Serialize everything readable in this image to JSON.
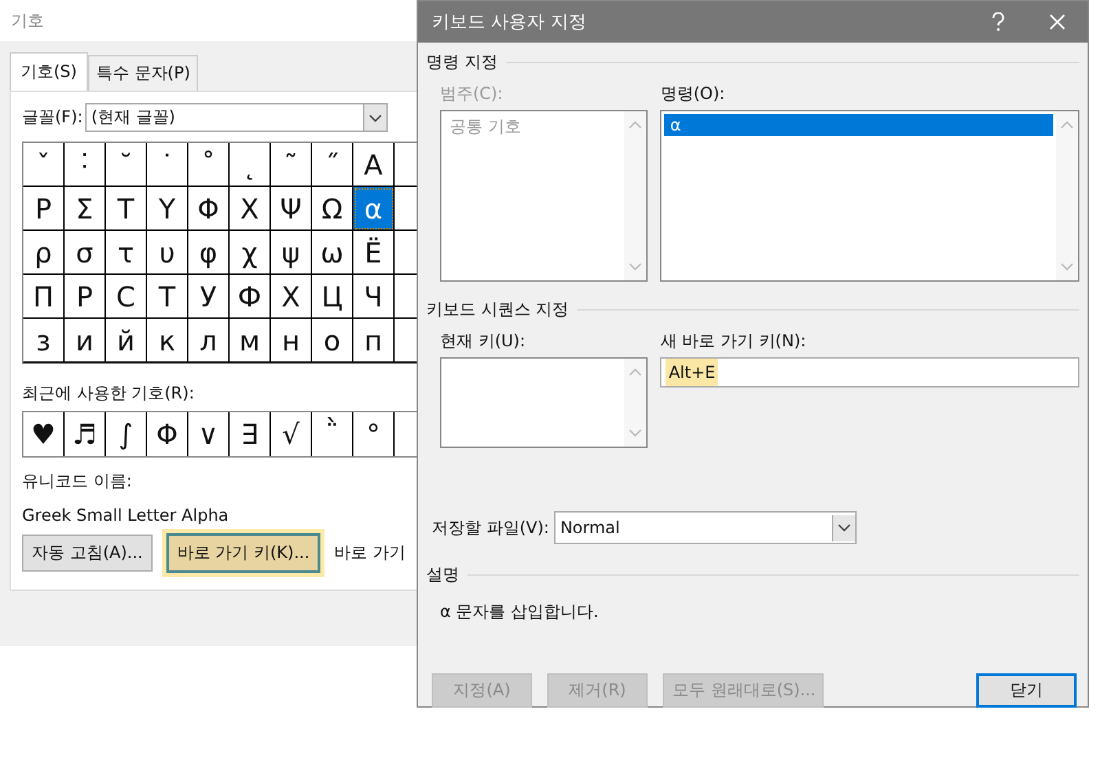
{
  "symbol_dialog": {
    "title": "기호",
    "tabs": [
      {
        "label": "기호(S)",
        "selected": true
      },
      {
        "label": "특수 문자(P)",
        "selected": false
      }
    ],
    "font": {
      "label": "글꼴(F):",
      "value": "(현재 글꼴)"
    },
    "symbol_grid": [
      [
        {
          "symbol": "ˇ",
          "selected": false
        },
        {
          "symbol": "˸",
          "selected": false
        },
        {
          "symbol": "˘",
          "selected": false
        },
        {
          "symbol": "˙",
          "selected": false
        },
        {
          "symbol": "˚",
          "selected": false
        },
        {
          "symbol": "˛",
          "selected": false
        },
        {
          "symbol": "˜",
          "selected": false
        },
        {
          "symbol": "˝",
          "selected": false
        },
        {
          "symbol": "Α",
          "selected": false
        }
      ],
      [
        {
          "symbol": "Ρ",
          "selected": false
        },
        {
          "symbol": "Σ",
          "selected": false
        },
        {
          "symbol": "Τ",
          "selected": false
        },
        {
          "symbol": "Υ",
          "selected": false
        },
        {
          "symbol": "Φ",
          "selected": false
        },
        {
          "symbol": "Χ",
          "selected": false
        },
        {
          "symbol": "Ψ",
          "selected": false
        },
        {
          "symbol": "Ω",
          "selected": false
        },
        {
          "symbol": "α",
          "selected": true
        }
      ],
      [
        {
          "symbol": "ρ",
          "selected": false
        },
        {
          "symbol": "σ",
          "selected": false
        },
        {
          "symbol": "τ",
          "selected": false
        },
        {
          "symbol": "υ",
          "selected": false
        },
        {
          "symbol": "φ",
          "selected": false
        },
        {
          "symbol": "χ",
          "selected": false
        },
        {
          "symbol": "ψ",
          "selected": false
        },
        {
          "symbol": "ω",
          "selected": false
        },
        {
          "symbol": "Ё",
          "selected": false
        }
      ],
      [
        {
          "symbol": "П",
          "selected": false
        },
        {
          "symbol": "Р",
          "selected": false
        },
        {
          "symbol": "С",
          "selected": false
        },
        {
          "symbol": "Т",
          "selected": false
        },
        {
          "symbol": "У",
          "selected": false
        },
        {
          "symbol": "Ф",
          "selected": false
        },
        {
          "symbol": "Х",
          "selected": false
        },
        {
          "symbol": "Ц",
          "selected": false
        },
        {
          "symbol": "Ч",
          "selected": false
        }
      ],
      [
        {
          "symbol": "з",
          "selected": false
        },
        {
          "symbol": "и",
          "selected": false
        },
        {
          "symbol": "й",
          "selected": false
        },
        {
          "symbol": "к",
          "selected": false
        },
        {
          "symbol": "л",
          "selected": false
        },
        {
          "symbol": "м",
          "selected": false
        },
        {
          "symbol": "н",
          "selected": false
        },
        {
          "symbol": "о",
          "selected": false
        },
        {
          "symbol": "п",
          "selected": false
        }
      ]
    ],
    "recent_label": "최근에 사용한 기호(R):",
    "recent_symbols": [
      "♥",
      "♬",
      "∫",
      "Φ",
      "∨",
      "∃",
      "√",
      "῭",
      "°"
    ],
    "unicode_name_label": "유니코드 이름:",
    "unicode_name": "Greek Small Letter Alpha",
    "buttons": [
      {
        "label": "자동 고침(A)...",
        "highlighted": false
      },
      {
        "label": "바로 가기 키(K)...",
        "highlighted": true
      }
    ],
    "shortcut_text": "바로 가기"
  },
  "keyboard_dialog": {
    "title": "키보드 사용자 지정",
    "command_section": "명령 지정",
    "categories": {
      "label": "범주(C):",
      "disabled": true,
      "items": [
        {
          "text": "공통 기호",
          "selected": false
        }
      ]
    },
    "commands": {
      "label": "명령(O):",
      "disabled": false,
      "items": [
        {
          "text": "α",
          "selected": true
        }
      ]
    },
    "sequence_section": "키보드 시퀀스 지정",
    "current_keys": {
      "label": "현재 키(U):"
    },
    "new_key": {
      "label": "새 바로 가기 키(N):",
      "value": "Alt+E",
      "highlighted": true
    },
    "save_in": {
      "label": "저장할 파일(V):",
      "value": "Normal"
    },
    "description_section": "설명",
    "description": "α 문자를 삽입합니다.",
    "buttons": [
      {
        "label": "지정(A)",
        "disabled": true,
        "default": false
      },
      {
        "label": "제거(R)",
        "disabled": true,
        "default": false
      },
      {
        "label": "모두 원래대로(S)...",
        "disabled": true,
        "default": false
      },
      {
        "label": "닫기",
        "disabled": false,
        "default": true
      }
    ]
  }
}
